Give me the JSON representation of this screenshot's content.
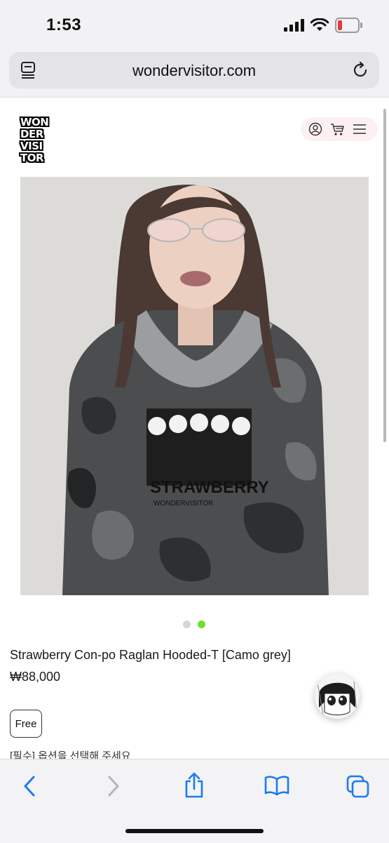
{
  "status_bar": {
    "time": "1:53"
  },
  "browser": {
    "url": "wondervisitor.com"
  },
  "site": {
    "logo_lines": [
      "WON",
      "DER",
      "VISI",
      "TOR"
    ]
  },
  "product": {
    "title": "Strawberry Con-po Raglan Hooded-T [Camo grey]",
    "price": "₩88,000",
    "image_print_text": [
      "STRAWBERRY",
      "WONDERVISITOR"
    ],
    "carousel": {
      "total": 2,
      "active": 2
    },
    "option_label": "Free",
    "option_hint": "[필수] 옵션을 선택해 주세요"
  },
  "icons": {
    "tabs": "tabs-overview-icon",
    "reload": "reload-icon",
    "user": "user-icon",
    "cart": "cart-icon",
    "menu": "menu-icon",
    "back": "back-icon",
    "forward": "forward-icon",
    "share": "share-icon",
    "bookmarks": "bookmarks-icon",
    "tabs_bottom": "tabs-icon"
  },
  "colors": {
    "accent_dot": "#6ee02a",
    "inactive_dot": "#d6d6d6",
    "ios_blue": "#1a7bf0",
    "header_pill": "#fdf0f2"
  }
}
